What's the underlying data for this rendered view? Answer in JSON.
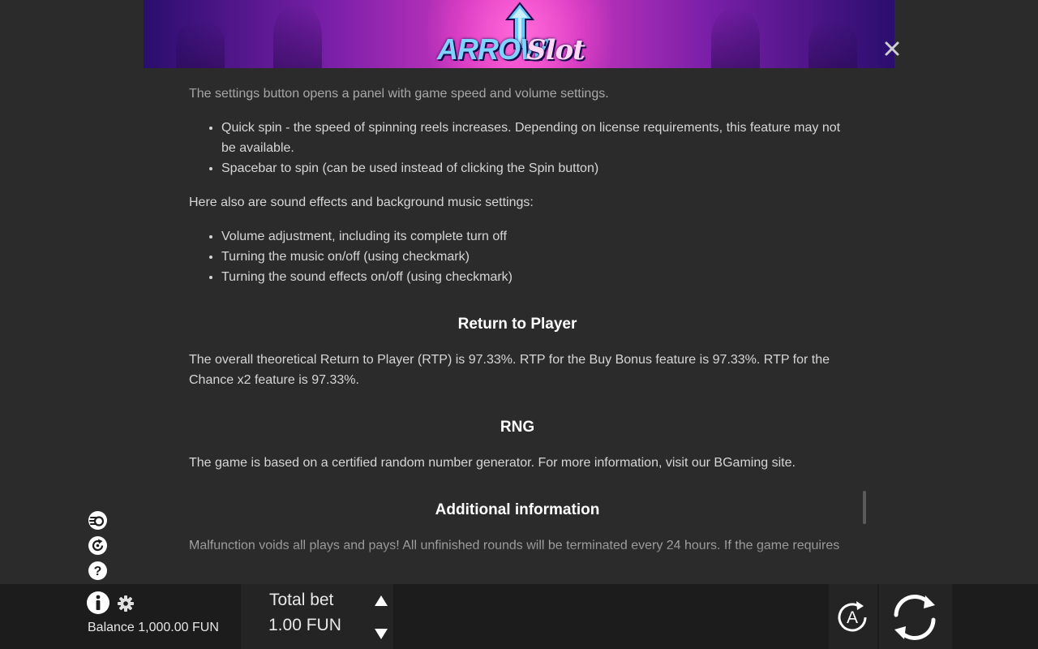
{
  "banner": {
    "logo_word_1": "ARROW",
    "logo_word_2": "Slot"
  },
  "icons": {
    "close": "close-icon",
    "quick_spin": "quick-spin-icon",
    "replay": "replay-icon",
    "help": "help-icon",
    "info": "info-icon",
    "settings": "gear-icon",
    "autoplay": "autoplay-icon",
    "spin": "spin-icon"
  },
  "content": {
    "intro": "The settings button opens a panel with game speed and volume settings.",
    "settings_list": [
      "Quick spin - the speed of spinning reels increases. Depending on license requirements, this feature may not be available.",
      "Spacebar to spin (can be used instead of clicking the Spin button)"
    ],
    "sound_intro": "Here also are sound effects and background music settings:",
    "sound_list": [
      "Volume adjustment, including its complete turn off",
      "Turning the music on/off (using checkmark)",
      "Turning the sound effects on/off (using checkmark)"
    ],
    "rtp_heading": "Return to Player",
    "rtp_text": "The overall theoretical Return to Player (RTP) is 97.33%. RTP for the Buy Bonus feature is 97.33%. RTP for the Chance x2 feature is 97.33%.",
    "rng_heading": "RNG",
    "rng_text": "The game is based on a certified random number generator. For more information, visit our BGaming site.",
    "additional_heading": "Additional information",
    "additional_text": "Malfunction voids all plays and pays! All unfinished rounds will be terminated every 24 hours. If the game requires"
  },
  "footer": {
    "balance": "Balance 1,000.00 FUN",
    "total_bet_label": "Total bet",
    "total_bet_value": "1.00 FUN"
  },
  "colors": {
    "background": "#2b2b2b",
    "bar": "#1c1c1c",
    "heading": "#ffffff",
    "text": "#d6d6d6"
  }
}
